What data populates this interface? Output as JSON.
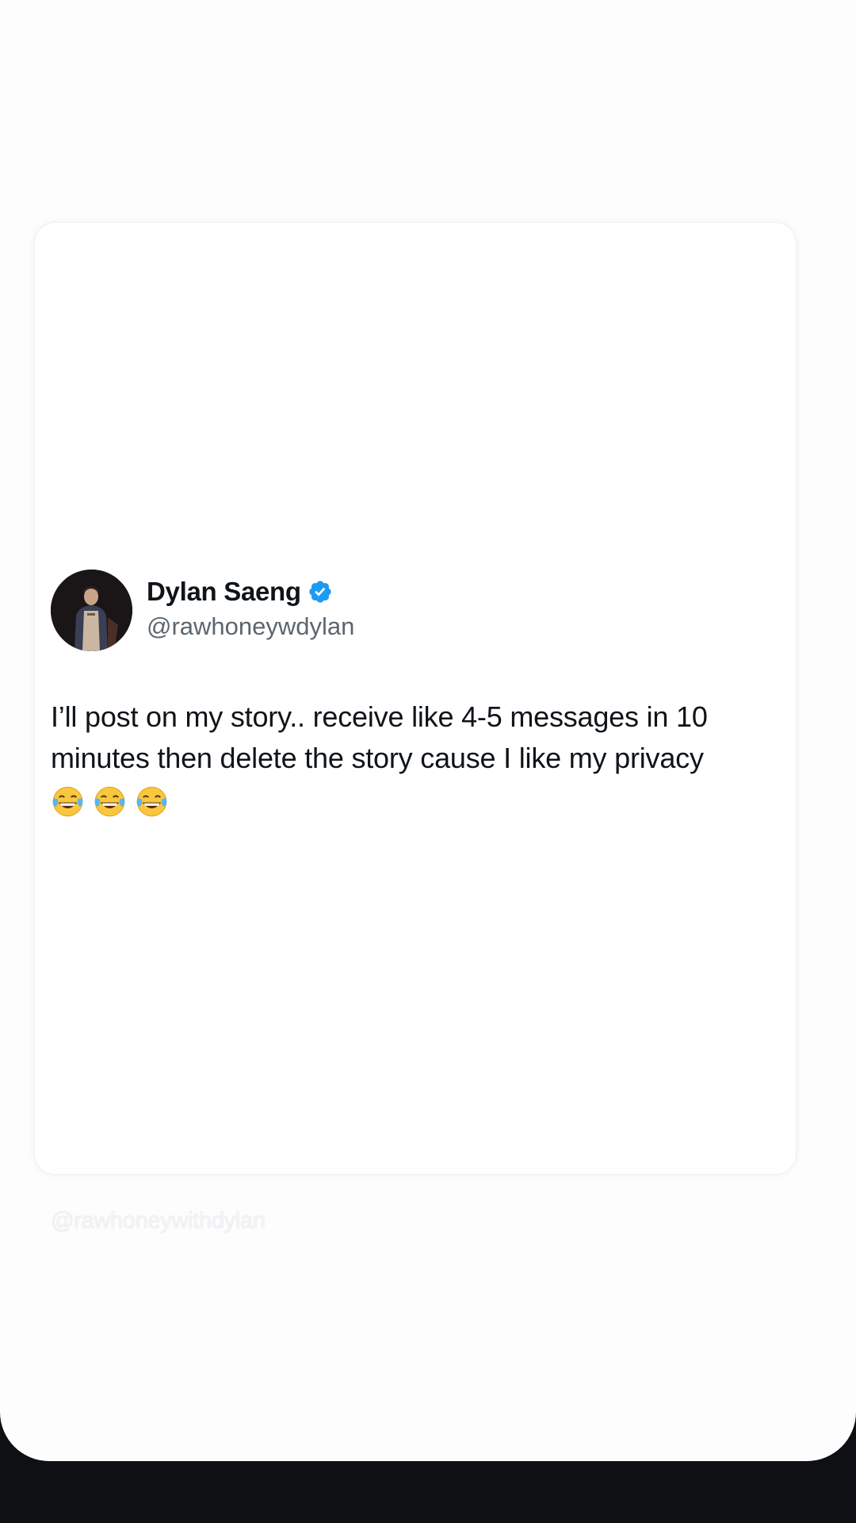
{
  "tweet": {
    "display_name": "Dylan Saeng",
    "handle": "@rawhoneywdylan",
    "verified": true,
    "text": "I’ll post on my story.. receive like 4-5 messages in 10 minutes then delete the story cause I like my privacy",
    "emojis": [
      "face-with-tears-of-joy",
      "face-with-tears-of-joy",
      "face-with-tears-of-joy"
    ]
  },
  "story": {
    "caption_handle": "@rawhoneywithdylan"
  },
  "colors": {
    "verified_badge": "#1d9bf0",
    "name_text": "#0f1419",
    "handle_text": "#5b6670",
    "bottom_bar": "#0e1014"
  }
}
